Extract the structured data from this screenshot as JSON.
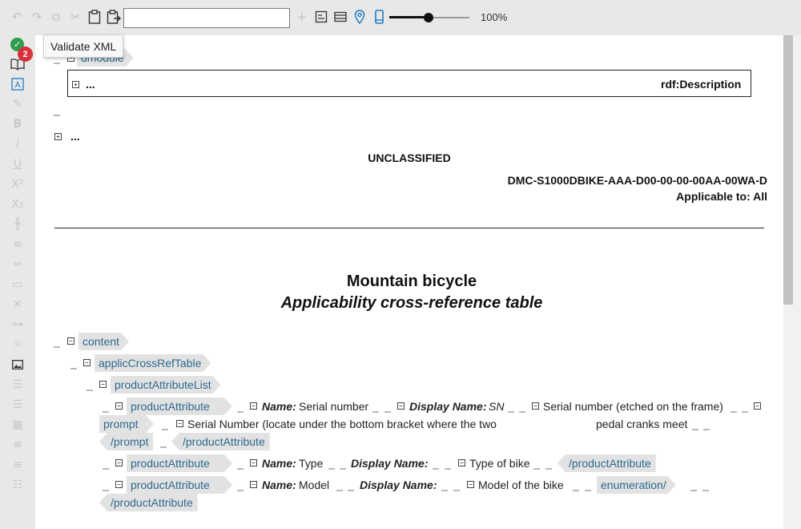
{
  "toolbar": {
    "icons": [
      "undo-icon",
      "redo-icon",
      "copy-icon",
      "cut-icon",
      "paste-icon",
      "paste-special-icon"
    ],
    "xpath_value": "",
    "right_icons": [
      "add-icon",
      "form-icon",
      "layout-icon",
      "location-pin-icon",
      "mobile-device-icon"
    ],
    "zoom": {
      "value": 49,
      "label": "100%"
    }
  },
  "tooltip": {
    "text": "Validate XML"
  },
  "sidebar": {
    "validate_badge": "2"
  },
  "document": {
    "dmodule_tag": "dmodule",
    "rdf_ellipsis": "...",
    "rdf_label": "rdf:Description",
    "ident_ellipsis": "...",
    "security": "UNCLASSIFIED",
    "dmc": "DMC-S1000DBIKE-AAA-D00-00-00-00AA-00WA-D",
    "applicable": "Applicable to: All",
    "title_main": "Mountain bicycle",
    "title_sub": "Applicability cross-reference table",
    "tags": {
      "content": "content",
      "act": "applicCrossRefTable",
      "pal": "productAttributeList",
      "pa": "productAttribute",
      "pa_close": "/productAttribute",
      "prompt": "prompt",
      "prompt_close": "/prompt",
      "enumeration": "enumeration/"
    },
    "labels": {
      "name": "Name:",
      "display_name": "Display Name:"
    },
    "attr1": {
      "name": "Serial number",
      "display": "SN",
      "description": "Serial number (etched on the frame)",
      "prompt_text": "Serial Number (locate under the bottom bracket where the two",
      "prompt_text2": "pedal cranks meet"
    },
    "attr2": {
      "name": "Type",
      "description": "Type of bike"
    },
    "attr3": {
      "name": "Model",
      "description": "Model of the bike"
    }
  },
  "colors": {
    "tag_text": "#2d6a8e",
    "tag_bg": "#e2e2e2",
    "accent": "#1e7bc4",
    "badge": "#d9303c",
    "valid": "#2e9e4d"
  }
}
